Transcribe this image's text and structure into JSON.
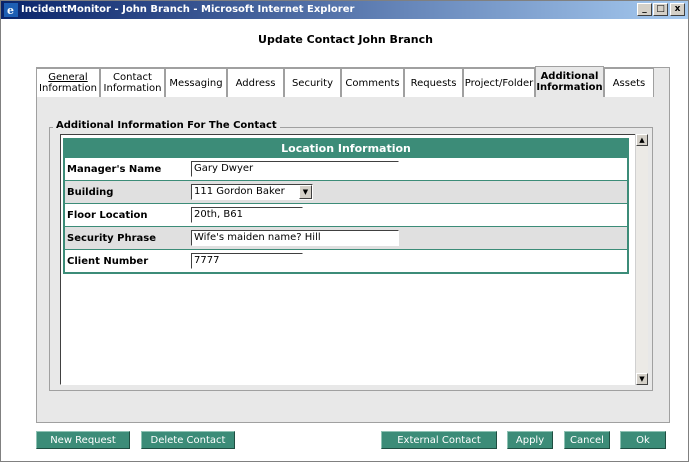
{
  "window": {
    "title": "IncidentMonitor - John Branch - Microsoft Internet Explorer",
    "minimize": "_",
    "maximize": "□",
    "close": "x"
  },
  "page": {
    "heading": "Update Contact John Branch"
  },
  "tabs": [
    {
      "line1": "General",
      "line2": "Information",
      "active": false
    },
    {
      "line1": "Contact",
      "line2": "Information",
      "active": false
    },
    {
      "line1": "Messaging",
      "line2": "",
      "active": false
    },
    {
      "line1": "Address",
      "line2": "",
      "active": false
    },
    {
      "line1": "Security",
      "line2": "",
      "active": false
    },
    {
      "line1": "Comments",
      "line2": "",
      "active": false
    },
    {
      "line1": "Requests",
      "line2": "",
      "active": false
    },
    {
      "line1": "Project/Folder",
      "line2": "",
      "active": false
    },
    {
      "line1": "Additional",
      "line2": "Information",
      "active": true
    },
    {
      "line1": "Assets",
      "line2": "",
      "active": false
    }
  ],
  "section": {
    "title": "Additional Information For The Contact",
    "table_header": "Location Information",
    "fields": [
      {
        "label": "Manager's Name",
        "value": "Gary Dwyer"
      },
      {
        "label": "Building",
        "value": "111 Gordon Baker"
      },
      {
        "label": "Floor Location",
        "value": "20th, B61"
      },
      {
        "label": "Security Phrase",
        "value": "Wife's maiden name? Hill"
      },
      {
        "label": "Client Number",
        "value": "7777"
      }
    ]
  },
  "buttons": {
    "new_request": "New Request",
    "delete_contact": "Delete Contact",
    "external_contact": "External Contact",
    "apply": "Apply",
    "cancel": "Cancel",
    "ok": "Ok"
  },
  "icons": {
    "browser": "ie-icon",
    "scroll_up": "scroll-up-icon",
    "scroll_down": "scroll-down-icon",
    "dropdown": "chevron-down-icon"
  },
  "colors": {
    "accent": "#3c8c78",
    "titlebar": "#0a246a"
  }
}
